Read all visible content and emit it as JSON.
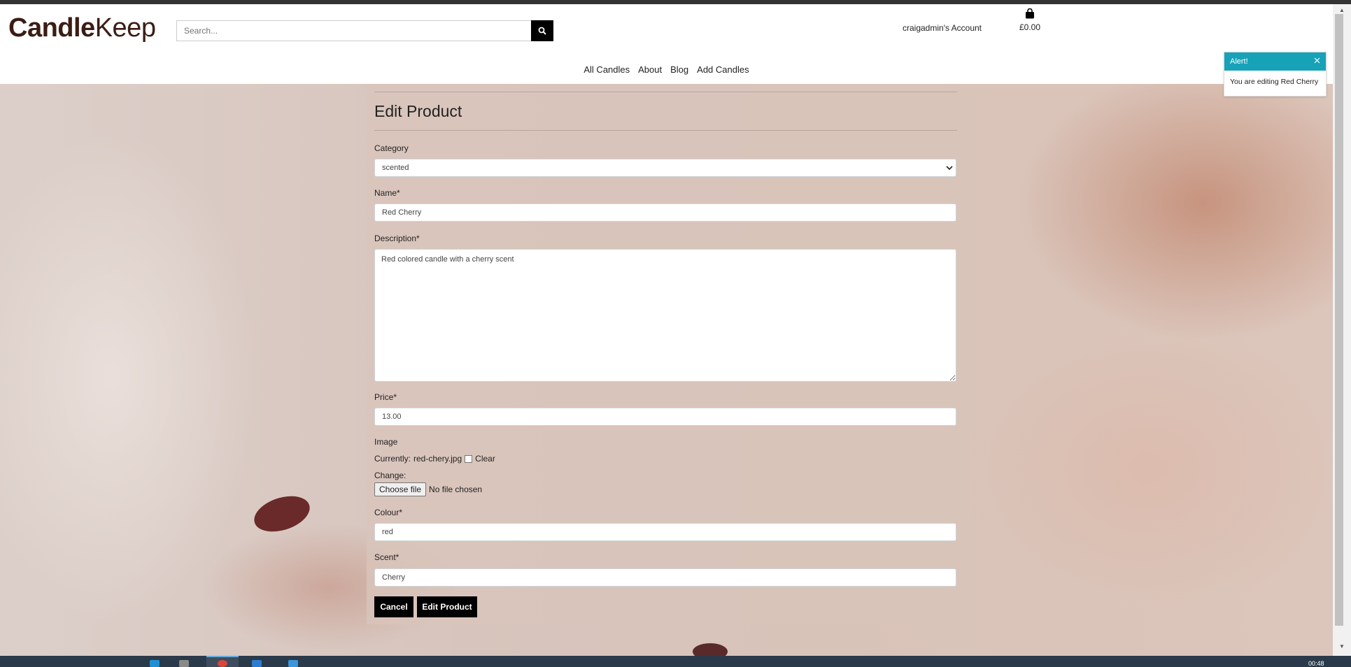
{
  "header": {
    "logo_bold": "Candle",
    "logo_light": "Keep",
    "search_placeholder": "Search...",
    "account_label": "craigadmin's Account",
    "bag_total": "£0.00"
  },
  "nav": {
    "items": [
      "All Candles",
      "About",
      "Blog",
      "Add Candles"
    ]
  },
  "toast": {
    "title": "Alert!",
    "message": "You are editing Red Cherry"
  },
  "form": {
    "title": "Edit Product",
    "category": {
      "label": "Category",
      "value": "scented"
    },
    "name": {
      "label": "Name*",
      "value": "Red Cherry"
    },
    "description": {
      "label": "Description*",
      "value": "Red colored candle with a cherry scent"
    },
    "price": {
      "label": "Price*",
      "value": "13.00"
    },
    "image": {
      "label": "Image",
      "currently_label": "Currently:",
      "current_file": "red-chery.jpg",
      "clear_label": "Clear",
      "change_label": "Change:",
      "choose_button": "Choose file",
      "no_file": "No file chosen"
    },
    "colour": {
      "label": "Colour*",
      "value": "red"
    },
    "scent": {
      "label": "Scent*",
      "value": "Cherry"
    },
    "cancel_button": "Cancel",
    "submit_button": "Edit Product"
  },
  "taskbar": {
    "clock": "00:48"
  },
  "colors": {
    "accent_toast": "#17a2b8",
    "button": "#000000",
    "logo": "#3b1d14"
  },
  "icons": [
    "search-icon",
    "shopping-bag-icon",
    "close-icon",
    "chevron-down-icon"
  ]
}
